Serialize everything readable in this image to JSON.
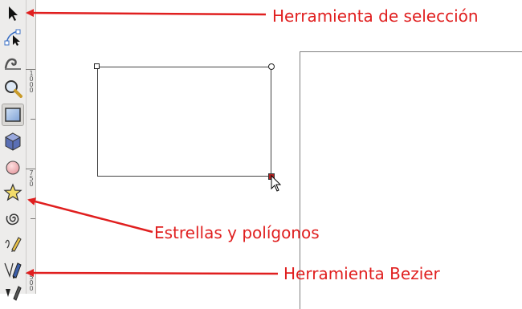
{
  "toolbox": {
    "tools": [
      {
        "name": "selector-icon"
      },
      {
        "name": "node-tool-icon"
      },
      {
        "name": "tweak-tool-icon"
      },
      {
        "name": "zoom-icon"
      },
      {
        "name": "rectangle-icon",
        "active": true
      },
      {
        "name": "3d-box-icon"
      },
      {
        "name": "ellipse-icon"
      },
      {
        "name": "star-icon"
      },
      {
        "name": "spiral-icon"
      },
      {
        "name": "pencil-icon"
      },
      {
        "name": "bezier-pen-icon"
      },
      {
        "name": "calligraphy-icon"
      }
    ]
  },
  "ruler": {
    "labels": [
      "1\n0\n0\n0",
      "7\n5\n0",
      "5\n0\n0"
    ]
  },
  "annotations": {
    "selection": "Herramienta de selección",
    "stars": "Estrellas y polígonos",
    "bezier": "Herramienta Bezier"
  },
  "colors": {
    "annotation": "#e01f1f",
    "toolbox_bg": "#edeceb",
    "handle_active": "#b02020"
  }
}
